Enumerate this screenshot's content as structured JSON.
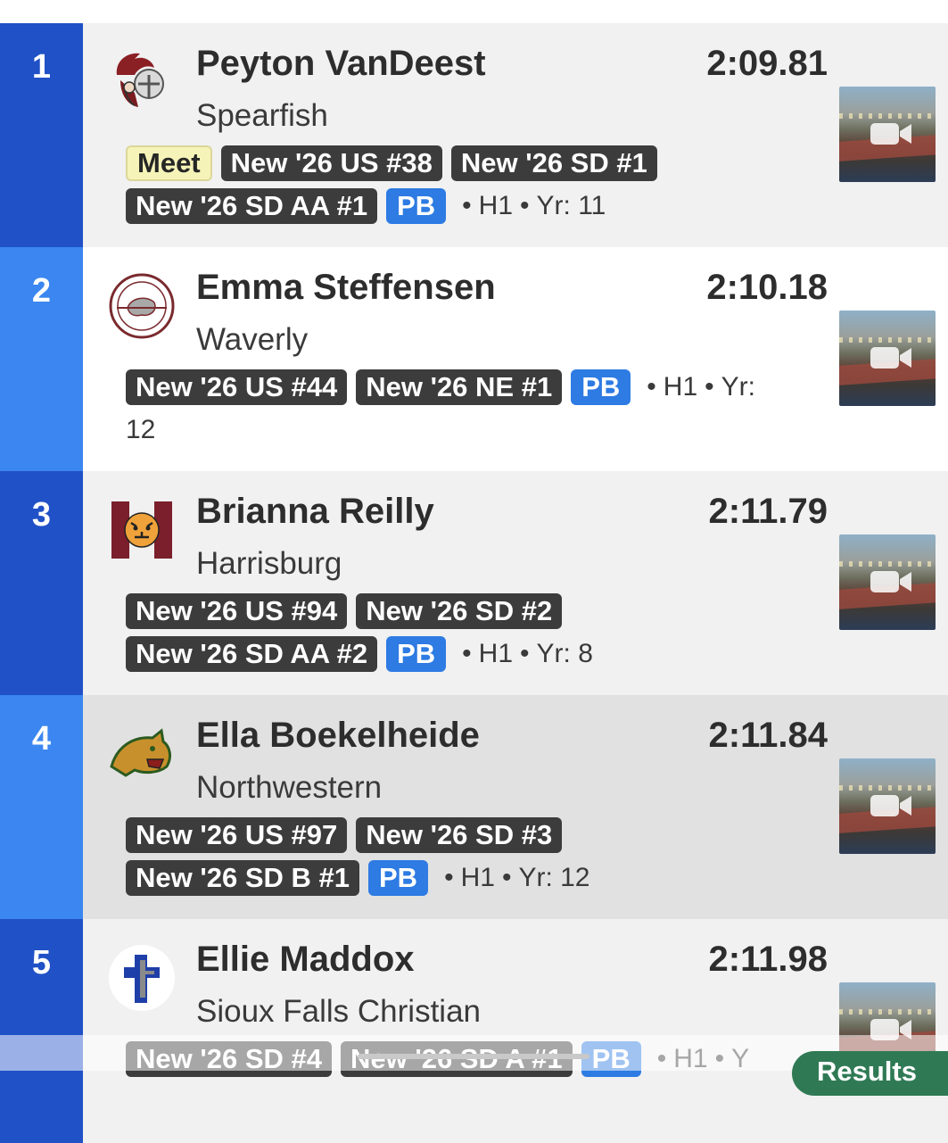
{
  "colors": {
    "place_dark": "#2051c7",
    "place_light": "#3b86f0",
    "row_light": "#f1f1f1",
    "row_highlight": "#e1e1e1",
    "chip_dark": "#3c3c3c",
    "chip_meet": "#f6f3b8",
    "chip_pb": "#2d7be3"
  },
  "video_icon": "video-camera-icon",
  "results": [
    {
      "place": "1",
      "name": "Peyton VanDeest",
      "team": "Spearfish",
      "time": "2:09.81",
      "logo": "spearfish-spartan-logo",
      "highlight": false,
      "chip_lines": [
        [
          "Meet",
          "New '26 US #38",
          "New '26 SD #1"
        ],
        [
          "New '26 SD AA #1",
          "PB"
        ]
      ],
      "meta": [
        "H1",
        "Yr: 11"
      ]
    },
    {
      "place": "2",
      "name": "Emma Steffensen",
      "team": "Waverly",
      "time": "2:10.18",
      "logo": "waverly-vikings-logo",
      "highlight": false,
      "chip_lines": [
        [
          "New '26 US #44",
          "New '26 NE #1",
          "PB"
        ]
      ],
      "meta": [
        "H1",
        "Yr:"
      ],
      "meta_wrap": "12"
    },
    {
      "place": "3",
      "name": "Brianna Reilly",
      "team": "Harrisburg",
      "time": "2:11.79",
      "logo": "harrisburg-tiger-logo",
      "highlight": false,
      "chip_lines": [
        [
          "New '26 US #94",
          "New '26 SD #2"
        ],
        [
          "New '26 SD AA #2",
          "PB"
        ]
      ],
      "meta": [
        "H1",
        "Yr: 8"
      ]
    },
    {
      "place": "4",
      "name": "Ella Boekelheide",
      "team": "Northwestern",
      "time": "2:11.84",
      "logo": "northwestern-wildcat-logo",
      "highlight": true,
      "chip_lines": [
        [
          "New '26 US #97",
          "New '26 SD #3"
        ],
        [
          "New '26 SD B #1",
          "PB"
        ]
      ],
      "meta": [
        "H1",
        "Yr: 12"
      ]
    },
    {
      "place": "5",
      "name": "Ellie Maddox",
      "team": "Sioux Falls Christian",
      "time": "2:11.98",
      "logo": "sioux-falls-christian-cross-logo",
      "highlight": false,
      "chip_lines": [
        [
          "New '26 SD #4",
          "New '26 SD A #1",
          "PB"
        ]
      ],
      "meta": [
        "H1",
        "Y"
      ]
    }
  ],
  "results_button": "Results"
}
